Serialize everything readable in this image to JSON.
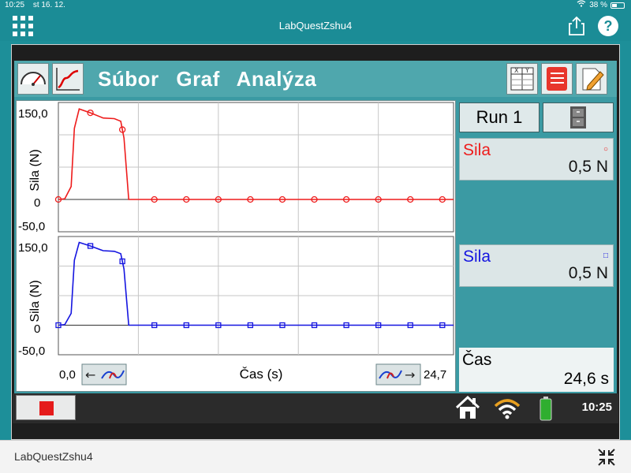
{
  "ios_status": {
    "time": "10:25",
    "date": "st 16. 12.",
    "battery": "38 %"
  },
  "nav": {
    "title": "LabQuestZshu4"
  },
  "menu": {
    "file": "Súbor",
    "graph": "Graf",
    "analysis": "Analýza"
  },
  "graph": {
    "x_axis_label": "Čas (s)",
    "x_min": "0,0",
    "x_max": "24,7",
    "top": {
      "y_label": "Sila (N)",
      "y_max_label": "150,0",
      "y_zero_label": "0",
      "y_min_label": "-50,0",
      "color": "#ee1c1c",
      "marker": "circle"
    },
    "bottom": {
      "y_label": "Sila (N)",
      "y_max_label": "150,0",
      "y_zero_label": "0",
      "y_min_label": "-50,0",
      "color": "#1515e0",
      "marker": "square"
    }
  },
  "chart_data": [
    {
      "type": "line",
      "title": "",
      "xlabel": "Čas (s)",
      "ylabel": "Sila (N)",
      "xlim": [
        0,
        24.7
      ],
      "ylim": [
        -50,
        150
      ],
      "series": [
        {
          "name": "Sila",
          "x": [
            0,
            0.4,
            0.8,
            1.0,
            1.3,
            2.0,
            2.8,
            3.5,
            3.9,
            4.1,
            4.4,
            5.0,
            8,
            12,
            16,
            20,
            24.7
          ],
          "y": [
            0,
            1,
            20,
            110,
            140,
            134,
            126,
            125,
            121,
            95,
            0,
            0,
            0,
            0,
            0,
            0,
            0
          ]
        }
      ]
    },
    {
      "type": "line",
      "title": "",
      "xlabel": "Čas (s)",
      "ylabel": "Sila (N)",
      "xlim": [
        0,
        24.7
      ],
      "ylim": [
        -50,
        150
      ],
      "series": [
        {
          "name": "Sila",
          "x": [
            0,
            0.4,
            0.8,
            1.0,
            1.3,
            2.0,
            2.8,
            3.5,
            3.9,
            4.1,
            4.4,
            5.0,
            8,
            12,
            16,
            20,
            24.7
          ],
          "y": [
            0,
            1,
            20,
            110,
            140,
            134,
            126,
            125,
            121,
            95,
            0,
            0,
            0,
            0,
            0,
            0,
            0
          ]
        }
      ]
    }
  ],
  "side": {
    "run_label": "Run 1",
    "meter1": {
      "name": "Sila",
      "value": "0,5 N",
      "color": "#ee1c1c"
    },
    "meter2": {
      "name": "Sila",
      "value": "0,5 N",
      "color": "#1515e0"
    },
    "time": {
      "name": "Čas",
      "value": "24,6 s"
    }
  },
  "bottom_bar": {
    "clock": "10:25"
  },
  "footer": {
    "label": "LabQuestZshu4"
  }
}
